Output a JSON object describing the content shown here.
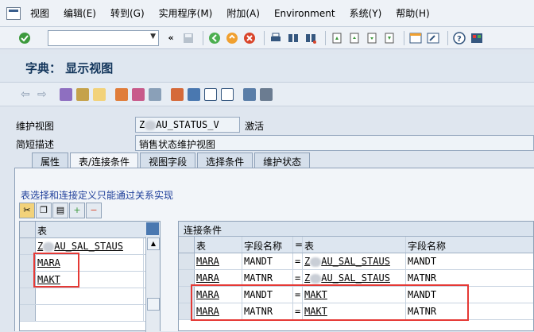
{
  "menubar": {
    "items": [
      "视图",
      "编辑(E)",
      "转到(G)",
      "实用程序(M)",
      "附加(A)",
      "Environment",
      "系统(Y)",
      "帮助(H)"
    ]
  },
  "title": "字典： 显示视图",
  "fields": {
    "view_label": "维护视图",
    "view_value_prefix": "Z",
    "view_value_suffix": "AU_STATUS_V",
    "view_status": "激活",
    "desc_label": "简短描述",
    "desc_value": "销售状态维护视图"
  },
  "tabs": [
    "属性",
    "表/连接条件",
    "视图字段",
    "选择条件",
    "维护状态"
  ],
  "active_tab": "表/连接条件",
  "info_text": "表选择和连接定义只能通过关系实现",
  "left_grid": {
    "header": "表",
    "rows": [
      {
        "prefix": "Z",
        "suffix": "AU_SAL_STAUS"
      },
      {
        "prefix": "",
        "suffix": "MARA"
      },
      {
        "prefix": "",
        "suffix": "MAKT"
      },
      {
        "prefix": "",
        "suffix": ""
      },
      {
        "prefix": "",
        "suffix": ""
      }
    ]
  },
  "right_grid": {
    "title": "连接条件",
    "columns": [
      "表",
      "字段名称",
      "=",
      "表",
      "字段名称"
    ],
    "rows": [
      {
        "t1": "MARA",
        "f1": "MANDT",
        "eq": "=",
        "t2p": "Z",
        "t2s": "AU_SAL_STAUS",
        "f2": "MANDT"
      },
      {
        "t1": "MARA",
        "f1": "MATNR",
        "eq": "=",
        "t2p": "Z",
        "t2s": "AU_SAL_STAUS",
        "f2": "MATNR"
      },
      {
        "t1": "MARA",
        "f1": "MANDT",
        "eq": "=",
        "t2p": "",
        "t2s": "MAKT",
        "f2": "MANDT"
      },
      {
        "t1": "MARA",
        "f1": "MATNR",
        "eq": "=",
        "t2p": "",
        "t2s": "MAKT",
        "f2": "MATNR"
      }
    ]
  },
  "icons": {
    "toolbar": [
      "check-icon",
      "save-icon",
      "back-icon",
      "exit-icon",
      "cancel-icon",
      "print-icon",
      "find-icon",
      "find-next-icon",
      "first-page-icon",
      "prev-page-icon",
      "next-page-icon",
      "last-page-icon",
      "new-session-icon",
      "shortcut-icon",
      "help-icon",
      "layout-icon"
    ]
  },
  "colors": {
    "accent": "#12355b",
    "highlight": "#e53935"
  }
}
